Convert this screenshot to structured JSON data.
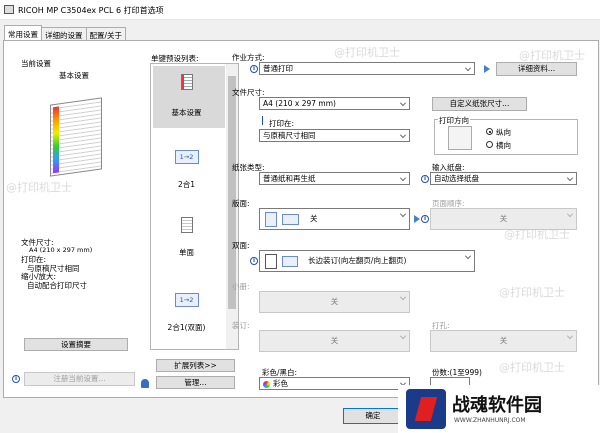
{
  "window": {
    "title": "RICOH MP C3504ex PCL 6 打印首选项"
  },
  "tabs": [
    {
      "label": "常用设置"
    },
    {
      "label": "详细的设置"
    },
    {
      "label": "配置/关于"
    }
  ],
  "watermark": "@打印机卫士",
  "current": {
    "heading": "当前设置",
    "preset_name": "基本设置",
    "paper_size_label": "文件尺寸:",
    "paper_size_value": "A4 (210 x 297 mm)",
    "print_on_label": "打印在:",
    "print_on_value": "与原稿尺寸相同",
    "scale_label": "缩小/放大:",
    "scale_value": "自动配合打印尺寸",
    "summary_button": "设置摘要",
    "register_button": "注册当前设置..."
  },
  "presets": {
    "heading": "单键预设列表:",
    "items": [
      {
        "label": "基本设置"
      },
      {
        "label": "2合1",
        "icon": "1→2"
      },
      {
        "label": "单面"
      },
      {
        "label": "2合1(双面)",
        "icon": "1→2"
      }
    ],
    "expand_button": "扩展列表>>",
    "manage_button": "管理..."
  },
  "settings": {
    "job_type_label": "作业方式:",
    "job_type_value": "普通打印",
    "details_button": "详细资料...",
    "doc_size_label": "文件尺寸:",
    "doc_size_value": "A4 (210 x 297 mm)",
    "custom_size_button": "自定义纸张尺寸...",
    "print_on_label": "打印在:",
    "print_on_value": "与原稿尺寸相同",
    "orientation_label": "打印方向",
    "orientation_portrait": "纵向",
    "orientation_landscape": "横向",
    "paper_type_label": "纸张类型:",
    "paper_type_value": "普通纸和再生纸",
    "input_tray_label": "输入纸盘:",
    "input_tray_value": "自动选择纸盘",
    "layout_label": "版面:",
    "layout_value": "关",
    "page_order_label": "页面顺序:",
    "page_order_value": "关",
    "duplex_label": "双面:",
    "duplex_value": "长边装订(向左翻页/向上翻页)",
    "booklet_label": "小册:",
    "booklet_value": "关",
    "staple_label": "装订:",
    "staple_value": "关",
    "punch_label": "打孔:",
    "punch_value": "关",
    "color_label": "彩色/黑白:",
    "color_value": "彩色",
    "copies_label": "份数:(1至999)"
  },
  "footer": {
    "ok_button": "确定"
  },
  "logo": {
    "name": "战魂软件园",
    "url": "WWW.ZHANHUNRJ.COM"
  }
}
